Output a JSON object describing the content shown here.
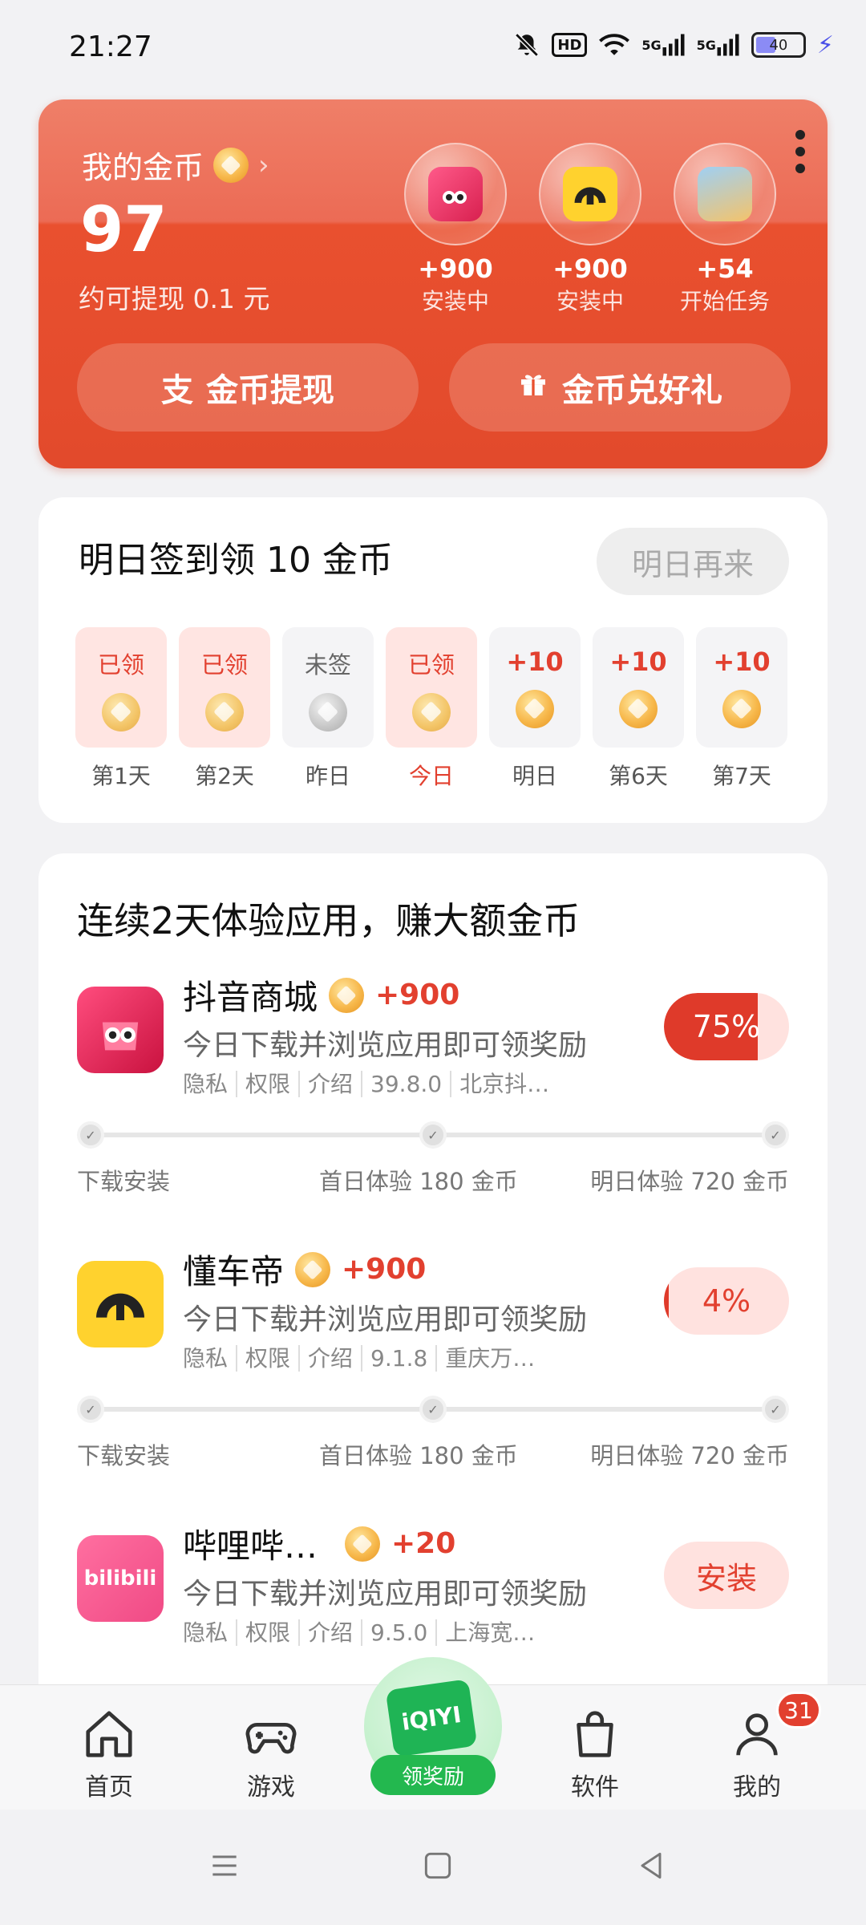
{
  "status_bar": {
    "time": "21:27",
    "battery": "40",
    "signal1": "5G",
    "signal2": "5G",
    "hd": "HD"
  },
  "coin_card": {
    "title": "我的金币",
    "amount": "97",
    "withdraw_hint": "约可提现 0.1 元",
    "tasks": [
      {
        "points": "+900",
        "status": "安装中",
        "icon": "douyin-mall-app-icon"
      },
      {
        "points": "+900",
        "status": "安装中",
        "icon": "dongchedi-app-icon"
      },
      {
        "points": "+54",
        "status": "开始任务",
        "icon": "avatar-app-icon"
      }
    ],
    "withdraw_button": "金币提现",
    "gift_button": "金币兑好礼"
  },
  "checkin": {
    "title": "明日签到领 10 金币",
    "comeback_button": "明日再来",
    "days": [
      {
        "status": "已领",
        "label": "第1天"
      },
      {
        "status": "已领",
        "label": "第2天"
      },
      {
        "status": "未签",
        "label": "昨日"
      },
      {
        "status": "已领",
        "label": "今日"
      },
      {
        "status": "+10",
        "label": "明日"
      },
      {
        "status": "+10",
        "label": "第6天"
      },
      {
        "status": "+10",
        "label": "第7天"
      }
    ]
  },
  "apps_section": {
    "title": "连续2天体验应用，赚大额金币",
    "apps": [
      {
        "name": "抖音商城",
        "reward": "+900",
        "desc": "今日下载并浏览应用即可领奖励",
        "meta": [
          "隐私",
          "权限",
          "介绍",
          "39.8.0",
          "北京抖…"
        ],
        "button": "75%",
        "progress": 0.75,
        "steps": [
          "下载安装",
          "首日体验 180 金币",
          "明日体验 720 金币"
        ]
      },
      {
        "name": "懂车帝",
        "reward": "+900",
        "desc": "今日下载并浏览应用即可领奖励",
        "meta": [
          "隐私",
          "权限",
          "介绍",
          "9.1.8",
          "重庆万…"
        ],
        "button": "4%",
        "progress": 0.04,
        "steps": [
          "下载安装",
          "首日体验 180 金币",
          "明日体验 720 金币"
        ]
      },
      {
        "name": "哔哩哔…",
        "reward": "+20",
        "desc": "今日下载并浏览应用即可领奖励",
        "meta": [
          "隐私",
          "权限",
          "介绍",
          "9.5.0",
          "上海宽…"
        ],
        "button": "安装"
      }
    ]
  },
  "tabbar": {
    "tabs": [
      "首页",
      "游戏",
      "软件",
      "我的"
    ],
    "center_label": "领奖励",
    "center_logo": "iQIYI",
    "badge": "31"
  },
  "colors": {
    "accent": "#e2402f",
    "card_top": "#ef7f68",
    "green": "#23b84f"
  }
}
